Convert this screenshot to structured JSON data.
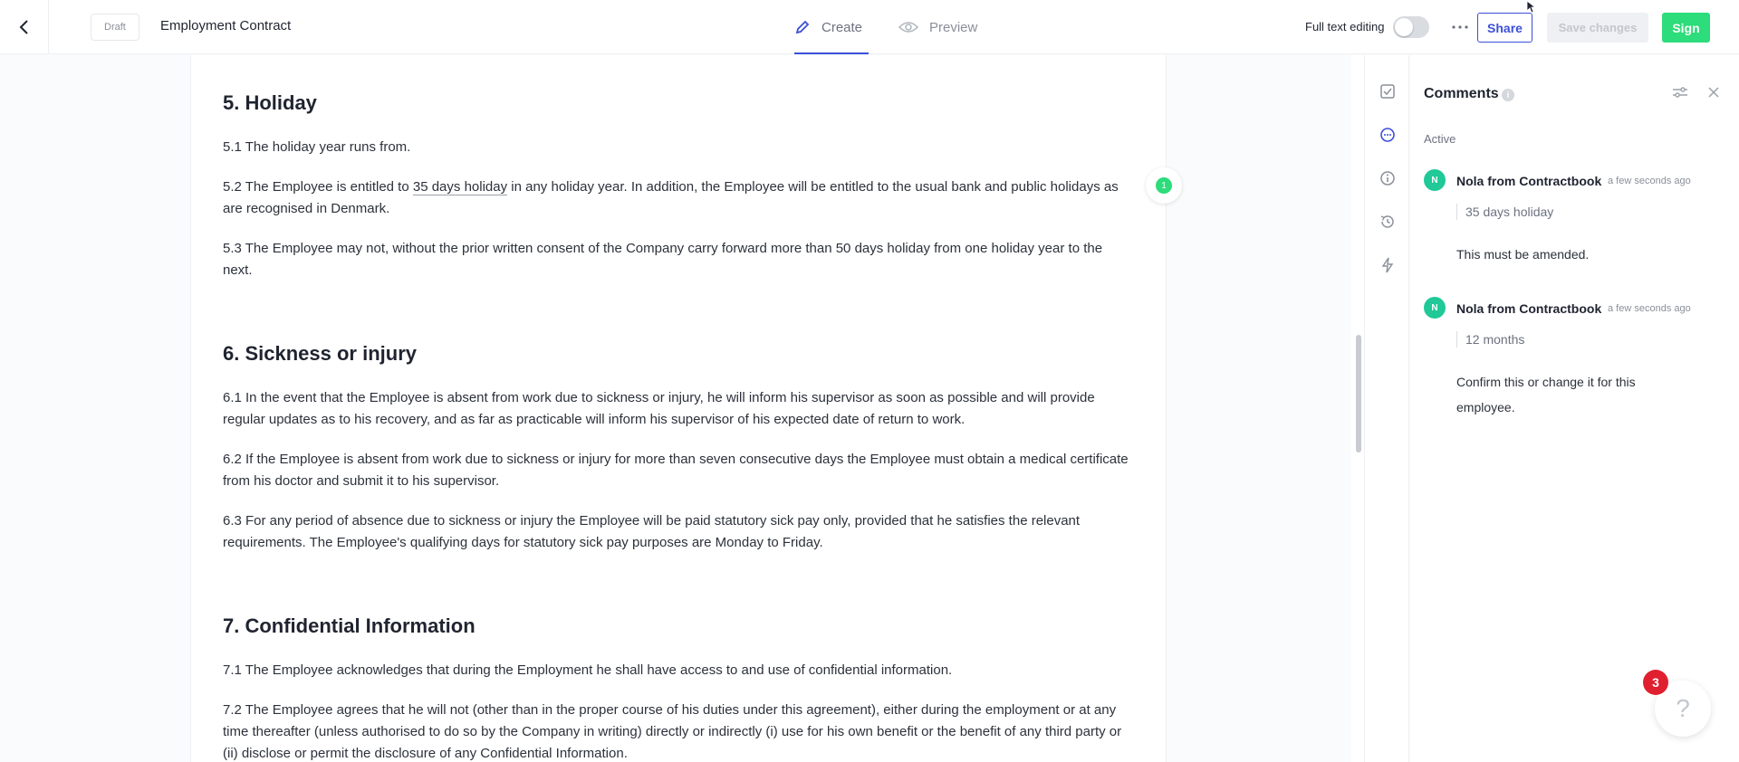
{
  "header": {
    "draft_badge": "Draft",
    "title": "Employment Contract",
    "tabs": [
      {
        "label": "Create",
        "active": true
      },
      {
        "label": "Preview",
        "active": false
      }
    ],
    "full_text_editing_label": "Full text editing",
    "full_text_editing_on": false,
    "share_label": "Share",
    "save_label": "Save changes",
    "sign_label": "Sign"
  },
  "document": {
    "sections": [
      {
        "heading": "5. Holiday",
        "paragraphs": [
          {
            "text": "5.1 The holiday year runs from."
          },
          {
            "before": "5.2 The Employee is entitled to ",
            "highlight": "35 days holiday",
            "after": " in any holiday year. In addition, the Employee will be entitled to the usual bank and public holidays as are recognised in Denmark."
          },
          {
            "text": "5.3 The Employee may not, without the prior written consent of the Company carry forward more than 50 days holiday from one holiday year to the next."
          }
        ]
      },
      {
        "heading": "6. Sickness or injury",
        "paragraphs": [
          {
            "text": "6.1 In the event that the Employee is absent from work due to sickness or injury, he will inform his supervisor as soon as possible and will provide regular updates as to his recovery, and as far as practicable will inform his supervisor of his expected date of return to work."
          },
          {
            "text": "6.2 If the Employee is absent from work due to sickness or injury for more than seven consecutive days the Employee must obtain a medical certificate from his doctor and submit it to his supervisor."
          },
          {
            "text": "6.3 For any period of absence due to sickness or injury the Employee will be paid statutory sick pay only, provided that he satisfies the relevant requirements. The Employee's qualifying days for statutory sick pay purposes are Monday to Friday."
          }
        ]
      },
      {
        "heading": "7. Confidential Information",
        "paragraphs": [
          {
            "text": "7.1 The Employee acknowledges that during the Employment he shall have access to and use of confidential information."
          },
          {
            "text": "7.2 The Employee agrees that he will not (other than in the proper course of his duties under this agreement), either during the employment or at any time thereafter (unless authorised to do so by the Company in writing) directly or indirectly (i) use for his own benefit or the benefit of any third party or (ii) disclose or permit the disclosure of any Confidential Information."
          }
        ]
      }
    ],
    "comment_marker_count": "1"
  },
  "comments_panel": {
    "title": "Comments",
    "info_glyph": "i",
    "section_label": "Active",
    "items": [
      {
        "avatar": "N",
        "author": "Nola from Contractbook",
        "time": "a few seconds ago",
        "quote": "35 days holiday",
        "body": "This must be amended."
      },
      {
        "avatar": "N",
        "author": "Nola from Contractbook",
        "time": "a few seconds ago",
        "quote": "12 months",
        "body": "Confirm this or change it for this employee."
      }
    ]
  },
  "help": {
    "notification_count": "3",
    "glyph": "?"
  },
  "colors": {
    "accent": "#3b4fd8",
    "sign_green": "#2ddc7a",
    "avatar_teal": "#20c997",
    "badge_red": "#e0202f"
  }
}
